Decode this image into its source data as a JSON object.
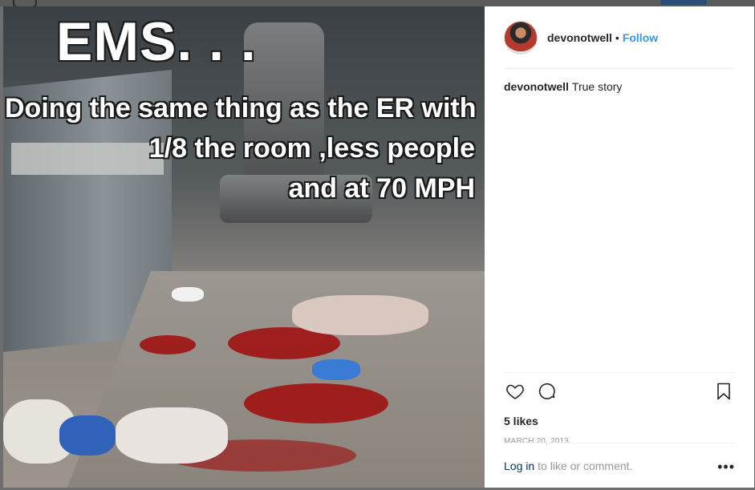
{
  "post": {
    "username": "devonotwell",
    "separator": "•",
    "follow_label": "Follow",
    "caption_user": "devonotwell",
    "caption_text": "True story",
    "likes": "5 likes",
    "date": "MARCH 20, 2013",
    "login_link": "Log in",
    "login_suffix": "to like or comment.",
    "more_label": "•••"
  },
  "image_text": {
    "title": "EMS. . .",
    "line1": "Doing the same thing as the ER with",
    "line2": "1/8 the room ,less people",
    "line3": "and at 70 MPH"
  },
  "icons": {
    "like": "heart-icon",
    "comment": "comment-icon",
    "save": "bookmark-icon"
  },
  "colors": {
    "follow": "#3897f0",
    "text": "#262626",
    "muted": "#999999",
    "link": "#003569"
  }
}
